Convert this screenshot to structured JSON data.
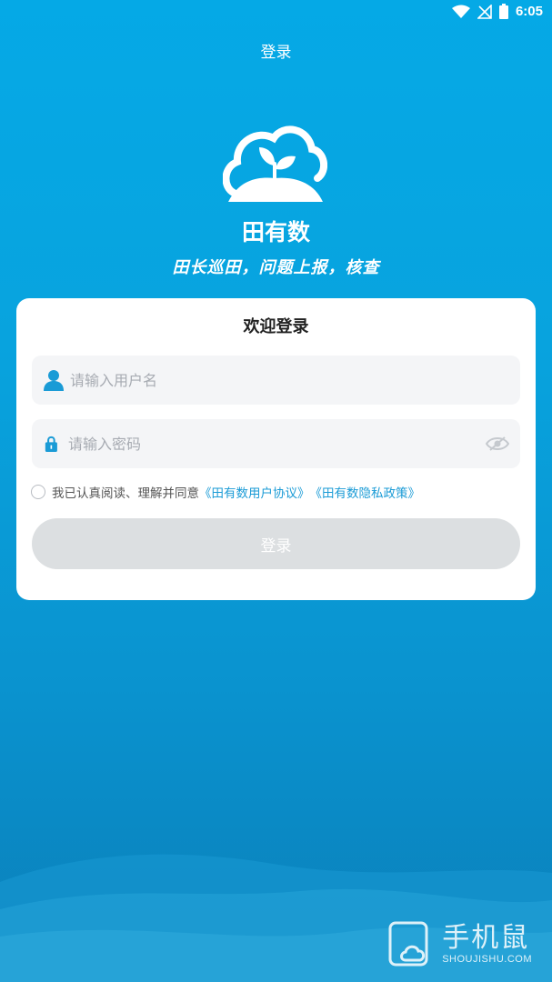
{
  "status_bar": {
    "time": "6:05"
  },
  "header": {
    "title": "登录"
  },
  "brand": {
    "app_name": "田有数",
    "slogan": "田长巡田，问题上报，核查"
  },
  "login_card": {
    "title": "欢迎登录",
    "username_placeholder": "请输入用户名",
    "password_placeholder": "请输入密码",
    "agreement_prefix": "我已认真阅读、理解并同意",
    "user_agreement_link": "《田有数用户协议》",
    "privacy_policy_link": "《田有数隐私政策》",
    "login_button_label": "登录",
    "agreement_checked": false
  },
  "watermark": {
    "name_cn": "手机鼠",
    "name_en": "SHOUJISHU.COM"
  },
  "colors": {
    "background_top": "#05a9e6",
    "background_bottom": "#0b7fb9",
    "accent": "#1a9bd6",
    "button_disabled": "#dcdfe1"
  }
}
